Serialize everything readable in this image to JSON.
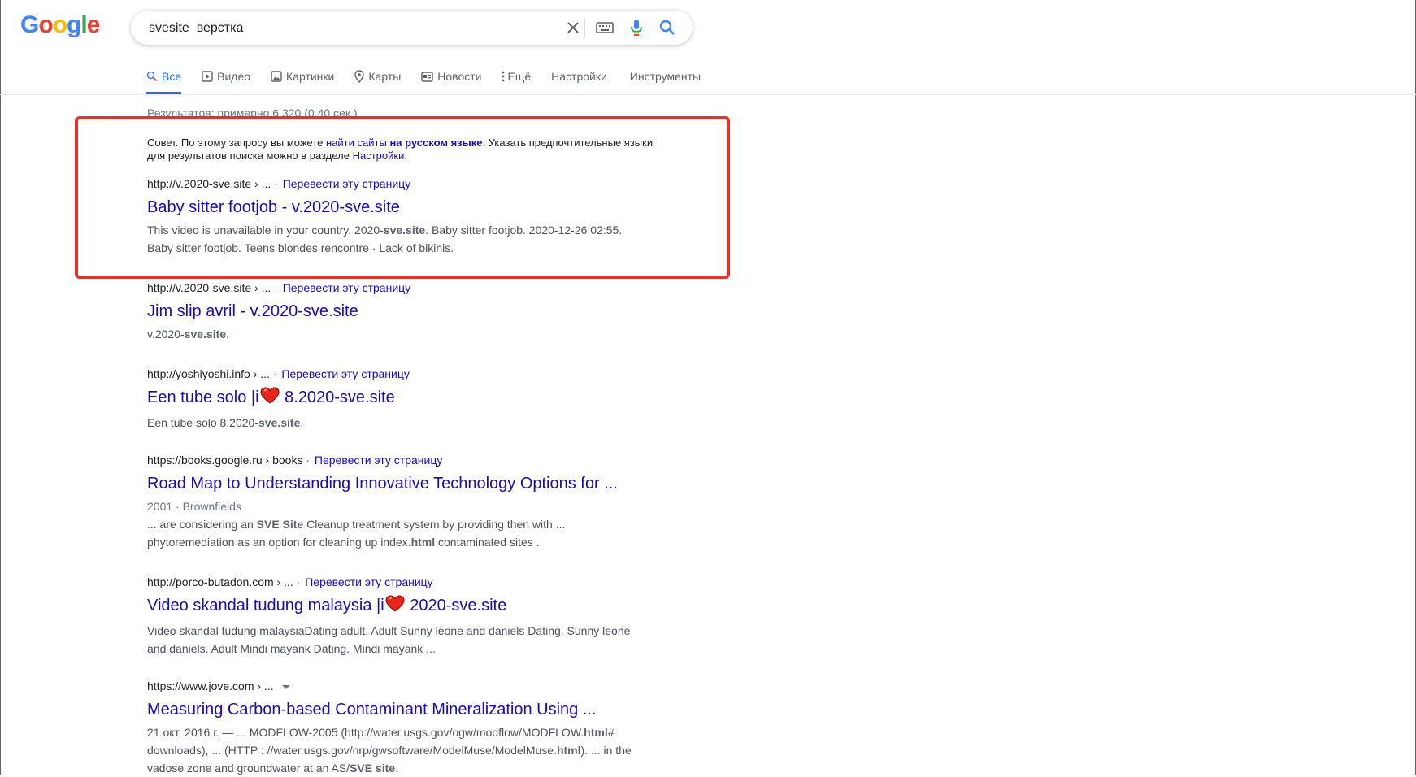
{
  "logo": {
    "letters": [
      "G",
      "o",
      "o",
      "g",
      "l",
      "e"
    ],
    "colors": [
      "#4285f4",
      "#ea4335",
      "#fbbc05",
      "#4285f4",
      "#34a853",
      "#ea4335"
    ]
  },
  "search": {
    "query": "svesite  верстка"
  },
  "tabs": [
    {
      "label": "Все",
      "icon": "search-icon"
    },
    {
      "label": "Видео",
      "icon": "video-icon"
    },
    {
      "label": "Картинки",
      "icon": "image-icon"
    },
    {
      "label": "Карты",
      "icon": "map-pin-icon"
    },
    {
      "label": "Новости",
      "icon": "news-icon"
    },
    {
      "label": "Ещё",
      "icon": "more-vert-icon"
    },
    {
      "label": "Настройки"
    },
    {
      "label": "Инструменты"
    }
  ],
  "stats": "Результатов: примерно 6 320 (0,40 сек.)",
  "tip": {
    "prefix": "Совет. По этому запросу вы можете ",
    "link1": "найти сайты",
    "space": " ",
    "link2": "на русском языке",
    "middle": ". Указать предпочтительные языки для результатов поиска можно в разделе ",
    "link3": "Настройки",
    "suffix": "."
  },
  "translate_label": "Перевести эту страницу",
  "separator": "·",
  "results": [
    {
      "cite": "http://v.2020-sve.site › ...",
      "title": "Baby sitter footjob - v.2020-sve.site",
      "snippet": {
        "a": "This video is unavailable in your country. 2020-",
        "b": "sve.site",
        "c": ". Baby sitter footjob. 2020-12-26 02:55. Baby sitter footjob. Teens blondes rencontre · Lack of bikinis."
      }
    },
    {
      "cite": "http://v.2020-sve.site › ...",
      "title": "Jim slip avril - v.2020-sve.site",
      "snippet": {
        "a": "v.2020-",
        "b": "sve.site",
        "c": "."
      }
    },
    {
      "cite": "http://yoshiyoshi.info › ...",
      "title_a": "Een tube solo |i",
      "title_b": " 8.2020-sve.site",
      "snippet": {
        "a": "Een tube solo 8.2020-",
        "b": "sve.site",
        "c": "."
      }
    },
    {
      "cite": "https://books.google.ru › books",
      "title": "Road Map to Understanding Innovative Technology Options for ...",
      "meta": "2001 · Brownfields",
      "snippet": {
        "a": "... are considering an ",
        "b": "SVE Site",
        "c": " Cleanup treatment system by providing then with ... phytoremediation as an option for cleaning up index.",
        "d": "html",
        "e": " contaminated sites ."
      }
    },
    {
      "cite": "http://porco-butadon.com › ...",
      "title_a": "Video skandal tudung malaysia |i",
      "title_b": " 2020-sve.site",
      "snippet": {
        "a": "Video skandal tudung malaysiaDating adult. Adult Sunny leone and daniels Dating. Sunny leone and daniels. Adult Mindi mayank Dating. Mindi mayank ..."
      }
    },
    {
      "cite": "https://www.jove.com › ...",
      "title": "Measuring Carbon-based Contaminant Mineralization Using ...",
      "snippet": {
        "a": "21 окт. 2016 г. — ... MODFLOW-2005 (http://water.usgs.gov/ogw/modflow/MODFLOW.",
        "b": "html",
        "c": "# downloads), ... (HTTP : //water.usgs.gov/nrp/gwsoftware/ModelMuse/ModelMuse.",
        "d": "html",
        "e": "). ... in the vadose zone and groundwater at an AS/",
        "f": "SVE site",
        "g": "."
      }
    }
  ]
}
